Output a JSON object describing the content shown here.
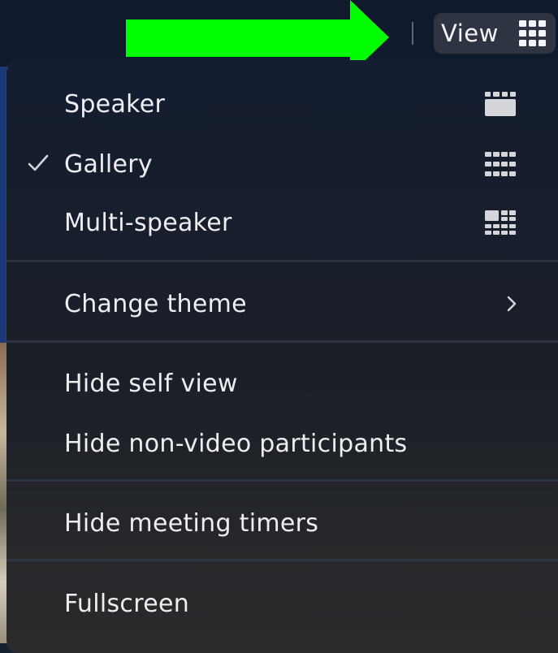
{
  "toolbar": {
    "view_label": "View",
    "view_icon": "grid-icon",
    "annotation_arrow_color": "#00ff00"
  },
  "menu": {
    "layout_items": [
      {
        "label": "Speaker",
        "icon": "speaker-view-icon",
        "checked": false
      },
      {
        "label": "Gallery",
        "icon": "gallery-view-icon",
        "checked": true
      },
      {
        "label": "Multi-speaker",
        "icon": "multi-speaker-view-icon",
        "checked": false
      }
    ],
    "theme_item": {
      "label": "Change theme",
      "icon": "chevron-right-icon"
    },
    "hide_items": [
      {
        "label": "Hide self view"
      },
      {
        "label": "Hide non-video participants"
      }
    ],
    "timer_item": {
      "label": "Hide meeting timers"
    },
    "fullscreen_item": {
      "label": "Fullscreen"
    }
  },
  "colors": {
    "menu_text": "#eceef1",
    "icon_gray": "#d4d6da",
    "separator": "#2c3240"
  }
}
